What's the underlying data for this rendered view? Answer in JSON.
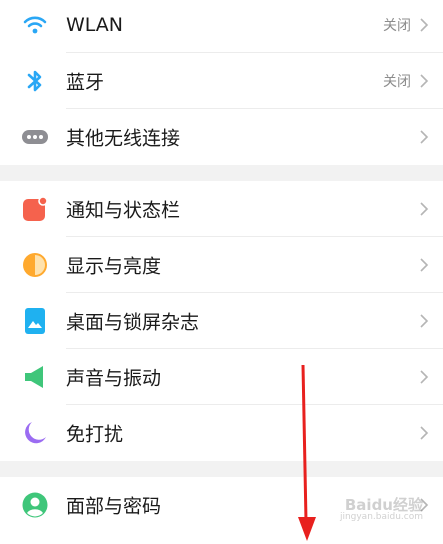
{
  "groups": [
    {
      "items": [
        {
          "label": "WLAN",
          "value": "关闭",
          "icon": "wifi-icon"
        },
        {
          "label": "蓝牙",
          "value": "关闭",
          "icon": "bluetooth-icon"
        },
        {
          "label": "其他无线连接",
          "value": "",
          "icon": "more-dots-icon"
        }
      ]
    },
    {
      "items": [
        {
          "label": "通知与状态栏",
          "value": "",
          "icon": "notification-icon"
        },
        {
          "label": "显示与亮度",
          "value": "",
          "icon": "brightness-icon"
        },
        {
          "label": "桌面与锁屏杂志",
          "value": "",
          "icon": "wallpaper-icon"
        },
        {
          "label": "声音与振动",
          "value": "",
          "icon": "speaker-icon"
        },
        {
          "label": "免打扰",
          "value": "",
          "icon": "moon-icon"
        }
      ]
    },
    {
      "items": [
        {
          "label": "面部与密码",
          "value": "",
          "icon": "face-lock-icon"
        }
      ]
    }
  ],
  "watermark": {
    "text": "Baidu经验",
    "sub": "jingyan.baidu.com"
  },
  "colors": {
    "wifi": "#2aa7f5",
    "bluetooth": "#2aa7f5",
    "dots": "#8e8e93",
    "notification": "#f5624d",
    "brightness": "#ffa92e",
    "wallpaper": "#1fb1f0",
    "speaker": "#3fc67a",
    "moon": "#9b6cf2",
    "face": "#3fc67a",
    "arrow": "#e8201e"
  }
}
